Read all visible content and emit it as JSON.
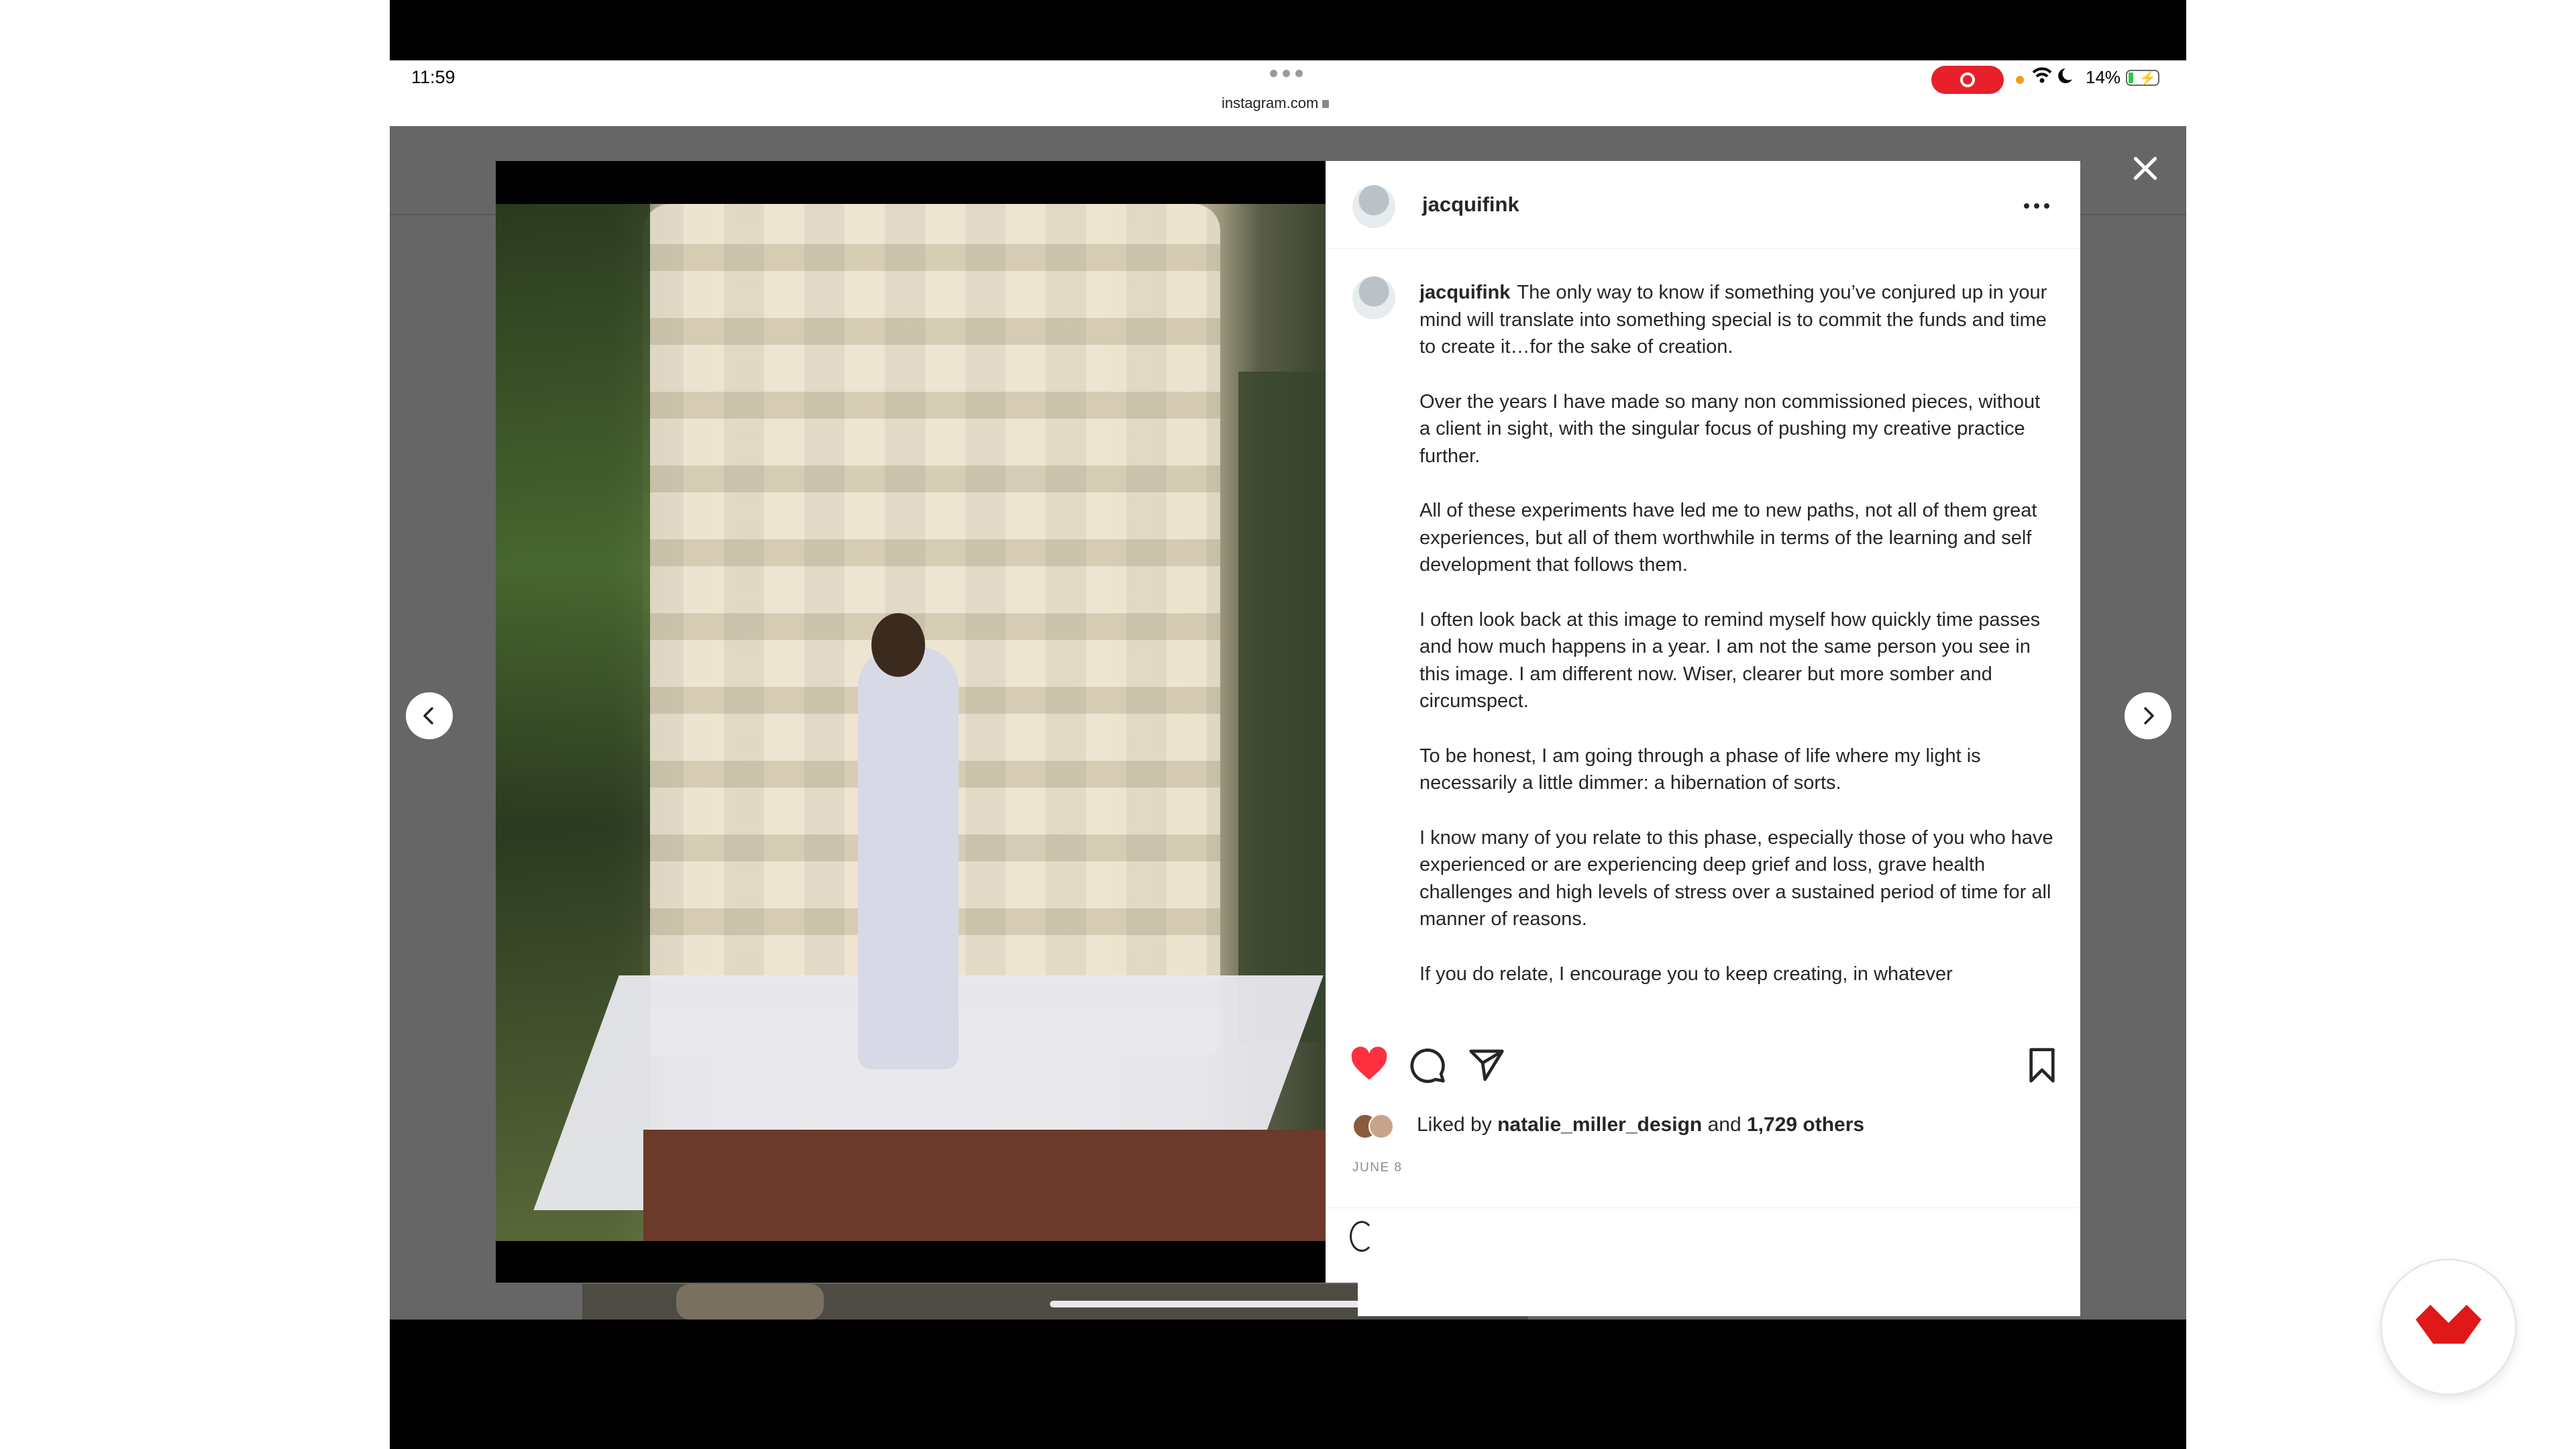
{
  "status_bar": {
    "time": "11:59",
    "url": "instagram.com",
    "battery": "14%"
  },
  "post": {
    "username": "jacquifink",
    "caption_paragraphs": [
      "The only way to know if something you’ve conjured up in your mind will translate into something special is to commit the funds and time to create it…for the sake of creation.",
      "Over the years I have made so many non commissioned pieces, without a client in sight, with the singular focus of pushing my creative practice further.",
      "All of these experiments have led me to new paths, not all of them great experiences, but all of them worthwhile in terms of the learning and self development that follows them.",
      "I often look back at this image to remind myself how quickly time passes and how much happens in a year. I am not the same person you see in this image. I am different now. Wiser, clearer but more somber and circumspect.",
      "To be honest, I am going through a phase of life where my light is necessarily a little dimmer: a hibernation of sorts.",
      "I know many of you relate to this phase, especially those of you who have experienced or are experiencing deep grief and loss, grave health challenges and high levels of stress over a sustained period of time for all manner of reasons.",
      "If you do relate, I encourage you to keep creating, in whatever"
    ],
    "likes": {
      "prefix": "Liked by",
      "user": "natalie_miller_design",
      "conjunction": "and",
      "others": "1,729 others"
    },
    "date": "JUNE 8"
  },
  "icons": {
    "like": "heart-icon-filled",
    "comment": "comment-icon",
    "share": "share-icon",
    "save": "bookmark-icon",
    "close": "close-icon",
    "prev": "chevron-left-icon",
    "next": "chevron-right-icon",
    "more": "more-icon"
  },
  "colors": {
    "like_red": "#ff3040",
    "text": "#262626",
    "muted": "#8e8e8e",
    "record_red": "#e8202a",
    "badge_red": "#e01818"
  }
}
